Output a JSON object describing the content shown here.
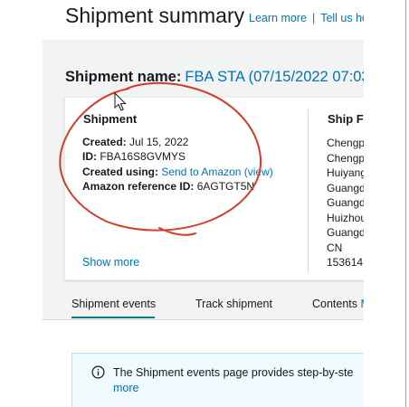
{
  "header": {
    "title": "Shipment summary",
    "learn_more": "Learn more",
    "separator": "|",
    "tell_us": "Tell us ho"
  },
  "shipment_name": {
    "label": "Shipment name:",
    "value": "FBA STA (07/15/2022 07:03"
  },
  "shipment_section": {
    "heading": "Shipment",
    "created_label": "Created:",
    "created_value": "Jul 15, 2022",
    "id_label": "ID:",
    "id_value": "FBA16S8GVMYS",
    "created_using_label": "Created using:",
    "created_using_value": "Send to Amazon",
    "view_link": "(view)",
    "amazon_ref_label": "Amazon reference ID:",
    "amazon_ref_value": "6AGTGT5N",
    "show_more": "Show more"
  },
  "ship_from": {
    "heading": "Ship Fr",
    "lines": [
      "Chengp",
      "Chengp",
      "Huiyang",
      "Guangd",
      "Guangd",
      "Huizhou",
      "Guangd",
      "CN",
      "153614"
    ]
  },
  "tabs": [
    {
      "label": "Shipment events",
      "active": true
    },
    {
      "label": "Track shipment",
      "active": false
    },
    {
      "label": "Contents",
      "active": false
    }
  ],
  "tab_contents_suffix": "M",
  "alert": {
    "icon": "info-icon",
    "line1": "The Shipment events page provides step-by-ste",
    "line2": "more"
  },
  "colors": {
    "link": "#0073bb",
    "annotation": "#d23c2a",
    "active_tab": "#0a7d8c"
  },
  "overlay": {
    "cursor_icon": "mouse-pointer-icon",
    "annotation": "hand-drawn-circle"
  }
}
